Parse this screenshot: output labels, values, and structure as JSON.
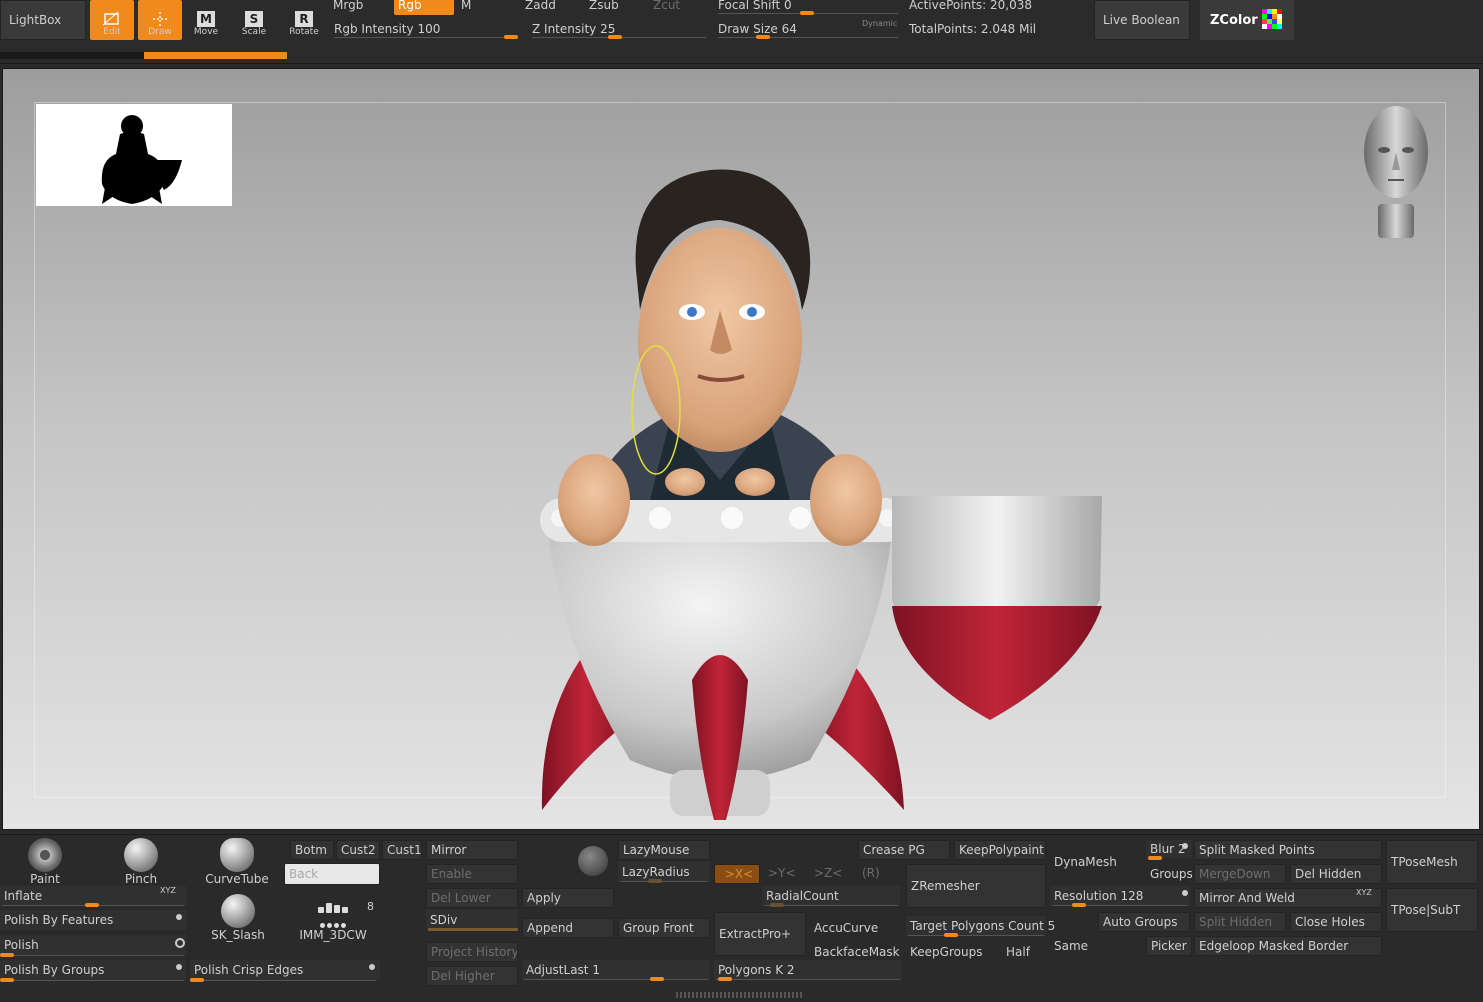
{
  "top": {
    "lightbox": "LightBox",
    "tools": [
      {
        "label": "Edit",
        "letter": "",
        "active": true
      },
      {
        "label": "Draw",
        "letter": "",
        "active": true
      },
      {
        "label": "Move",
        "letter": "M",
        "active": false
      },
      {
        "label": "Scale",
        "letter": "S",
        "active": false
      },
      {
        "label": "Rotate",
        "letter": "R",
        "active": false
      }
    ],
    "mrgb": "Mrgb",
    "rgb": "Rgb",
    "m": "M",
    "zadd": "Zadd",
    "zsub": "Zsub",
    "zcut": "Zcut",
    "rgb_intensity_label": "Rgb Intensity",
    "rgb_intensity_value": "100",
    "z_intensity_label": "Z Intensity",
    "z_intensity_value": "25",
    "focal_shift_label": "Focal Shift",
    "focal_shift_value": "0",
    "draw_size_label": "Draw Size",
    "draw_size_value": "64",
    "dynamic": "Dynamic",
    "active_points": "ActivePoints: 20,038",
    "total_points": "TotalPoints: 2.048 Mil",
    "live_boolean": "Live Boolean",
    "zcolor": "ZColor"
  },
  "bottom": {
    "brushes": {
      "paint": "Paint",
      "pinch": "Pinch",
      "curvetube": "CurveTube",
      "sk_slash": "SK_Slash",
      "imm": "IMM_3DCW",
      "imm_count": "8"
    },
    "inflate": "Inflate",
    "xyz": "XYZ",
    "polish_by_features": "Polish By Features",
    "polish": "Polish",
    "polish_by_groups": "Polish By Groups",
    "polish_crisp_edges": "Polish Crisp Edges",
    "botm": "Botm",
    "cust2": "Cust2",
    "cust1": "Cust1",
    "back": "Back",
    "mirror": "Mirror",
    "enable": "Enable",
    "del_lower": "Del Lower",
    "sdiv": "SDiv",
    "project_history": "Project History",
    "del_higher": "Del Higher",
    "apply": "Apply",
    "append": "Append",
    "group_front": "Group Front",
    "adjust_last": "AdjustLast 1",
    "lazymouse": "LazyMouse",
    "lazyradius": "LazyRadius",
    "x_sym": ">X<",
    "y_sym": ">Y<",
    "z_sym": ">Z<",
    "r_sym": "(R)",
    "radialcount": "RadialCount",
    "extractpro": "ExtractPro+",
    "accucurve": "AccuCurve",
    "backfacemask": "BackfaceMask",
    "polygons_k": "Polygons K 2",
    "crease_pg": "Crease PG",
    "keep_polypaint": "KeepPolypaint",
    "zremesher": "ZRemesher",
    "target_polygons": "Target Polygons Count 5",
    "keepgroups": "KeepGroups",
    "half": "Half",
    "same": "Same",
    "dynamesh": "DynaMesh",
    "resolution": "Resolution 128",
    "auto_groups": "Auto Groups",
    "blur": "Blur 2",
    "groups": "Groups",
    "picker": "Picker",
    "split_masked_points": "Split Masked Points",
    "mergedown": "MergeDown",
    "del_hidden": "Del Hidden",
    "mirror_and_weld": "Mirror And Weld",
    "split_hidden": "Split Hidden",
    "close_holes": "Close Holes",
    "edgeloop_masked_border": "Edgeloop Masked Border",
    "tposemesh": "TPoseMesh",
    "tpose_subt": "TPose|SubT"
  },
  "colors": {
    "accent": "#f08a1c",
    "rocket_red": "#b01f32"
  }
}
